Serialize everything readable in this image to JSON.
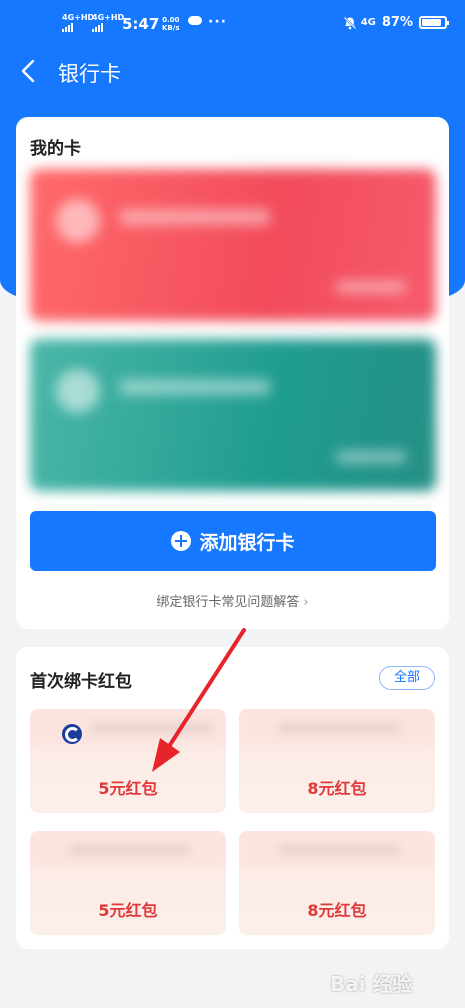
{
  "status_bar": {
    "network1": "4G+HD",
    "network2": "4G+HD",
    "time": "5:47",
    "speed_value": "0.00",
    "speed_unit": "KB/s",
    "more": "···",
    "network3": "4G",
    "battery": "87%",
    "battery_level": 0.87
  },
  "nav": {
    "back_icon": "chevron-left-icon",
    "title": "银行卡"
  },
  "my_cards": {
    "heading": "我的卡",
    "cards": [
      {
        "color": "#f24b5b"
      },
      {
        "color": "#1f9c90"
      }
    ],
    "add_button_label": "添加银行卡",
    "faq_label": "绑定银行卡常见问题解答"
  },
  "red_packets": {
    "heading": "首次绑卡红包",
    "all_label": "全部",
    "items": [
      {
        "amount": "5元红包"
      },
      {
        "amount": "8元红包"
      },
      {
        "amount": "5元红包"
      },
      {
        "amount": "8元红包"
      }
    ]
  },
  "watermark": "Bai 经验",
  "colors": {
    "primary": "#1677ff",
    "packet_text": "#e0393a",
    "annotation_arrow": "#e8242b"
  }
}
